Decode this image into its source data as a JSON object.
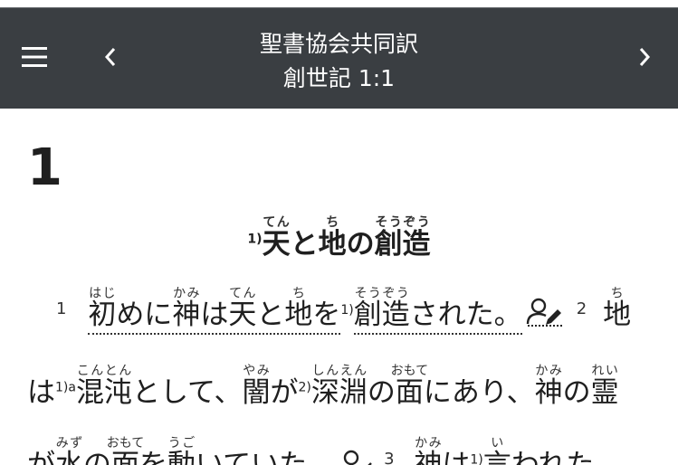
{
  "header": {
    "title": "聖書協会共同訳",
    "reference": "創世記 1:1",
    "menu_icon": "hamburger-menu-icon",
    "prev_icon": "chevron-left-icon",
    "next_icon": "chevron-right-icon"
  },
  "content": {
    "chapter_number": "1",
    "heading": {
      "footnote": "1)",
      "words": [
        {
          "base": "天",
          "ruby": "てん"
        },
        {
          "base": "と",
          "ruby": ""
        },
        {
          "base": "地",
          "ruby": "ち"
        },
        {
          "base": "の",
          "ruby": ""
        },
        {
          "base": "創造",
          "ruby": "そうぞう"
        }
      ]
    },
    "verses": {
      "v1_num": "1",
      "v2_num": "2",
      "v3_num": "3",
      "line1": [
        {
          "base": "初",
          "ruby": "はじ"
        },
        {
          "base": "めに",
          "ruby": ""
        },
        {
          "base": "神",
          "ruby": "かみ"
        },
        {
          "base": "は",
          "ruby": ""
        },
        {
          "base": "天",
          "ruby": "てん"
        },
        {
          "base": "と",
          "ruby": ""
        },
        {
          "base": "地",
          "ruby": "ち"
        },
        {
          "base": "を",
          "ruby": ""
        }
      ],
      "line1_fn": "1)",
      "line1b": [
        {
          "base": "創造",
          "ruby": "そうぞう"
        },
        {
          "base": "された。",
          "ruby": ""
        }
      ],
      "line1_end": {
        "base": "地",
        "ruby": "ち"
      },
      "line2_start": "は",
      "line2_fn1": "1)a",
      "line2a": [
        {
          "base": "混沌",
          "ruby": "こんとん"
        },
        {
          "base": "として、",
          "ruby": ""
        },
        {
          "base": "闇",
          "ruby": "やみ"
        },
        {
          "base": "が",
          "ruby": ""
        }
      ],
      "line2_fn2": "2)",
      "line2b": [
        {
          "base": "深淵",
          "ruby": "しんえん"
        },
        {
          "base": "の",
          "ruby": ""
        },
        {
          "base": "面",
          "ruby": "おもて"
        },
        {
          "base": "にあり、",
          "ruby": ""
        },
        {
          "base": "神",
          "ruby": "かみ"
        },
        {
          "base": "の",
          "ruby": ""
        },
        {
          "base": "霊",
          "ruby": "れい"
        }
      ],
      "line3": [
        {
          "base": "が",
          "ruby": ""
        },
        {
          "base": "水",
          "ruby": "みず"
        },
        {
          "base": "の",
          "ruby": ""
        },
        {
          "base": "面",
          "ruby": "おもて"
        },
        {
          "base": "を",
          "ruby": ""
        },
        {
          "base": "動",
          "ruby": "うご"
        },
        {
          "base": "いていた。",
          "ruby": ""
        }
      ],
      "line3b": [
        {
          "base": "神",
          "ruby": "かみ"
        },
        {
          "base": "は",
          "ruby": ""
        }
      ],
      "line3_fn": "1)",
      "line3c": [
        {
          "base": "言",
          "ruby": "い"
        },
        {
          "base": "われた",
          "ruby": ""
        }
      ]
    },
    "note_icon": "person-edit-icon"
  },
  "colors": {
    "header_bg": "#3a3e42",
    "text": "#1f1f1f"
  }
}
